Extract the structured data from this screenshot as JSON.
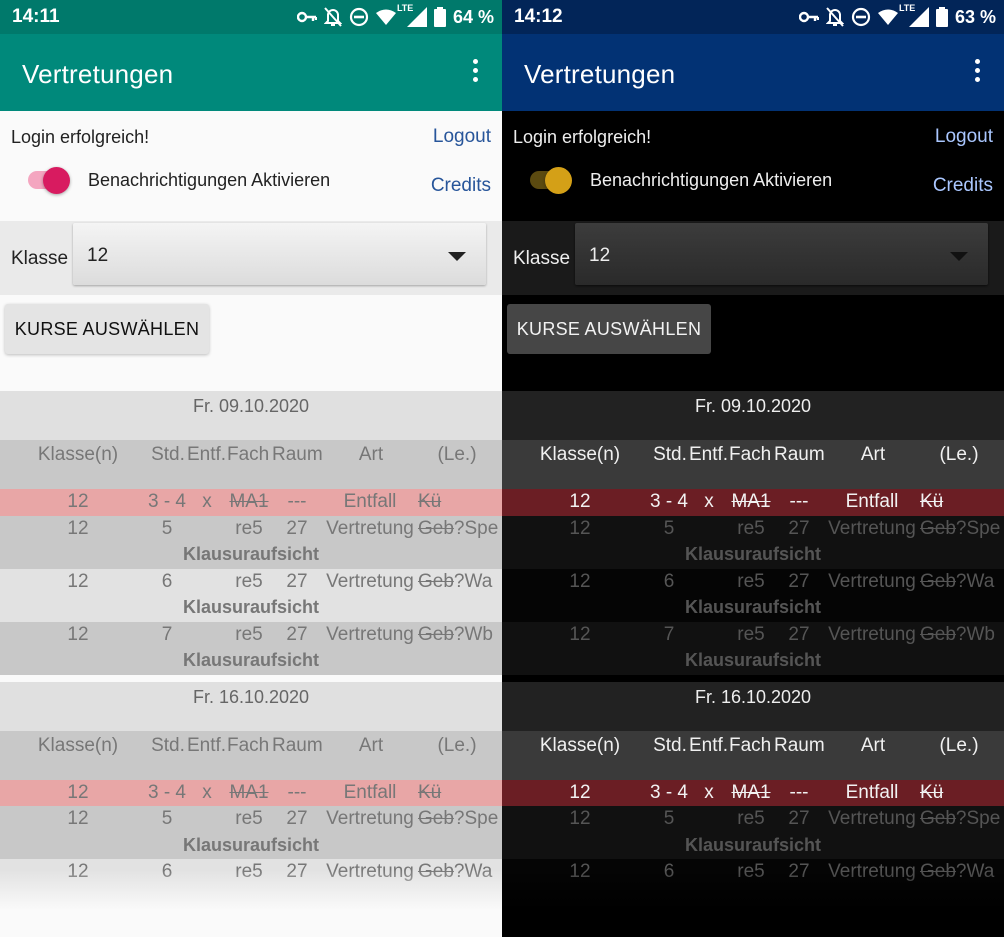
{
  "screens": [
    {
      "theme": "light",
      "status": {
        "time": "14:11",
        "battery": "64 %",
        "network": "LTE"
      },
      "appbar": {
        "title": "Vertretungen"
      },
      "login_text": "Login erfolgreich!",
      "logout_label": "Logout",
      "credits_label": "Credits",
      "notifications_label": "Benachrichtigungen Aktivieren",
      "notifications_enabled": true,
      "klasse_label": "Klasse",
      "klasse_value": "12",
      "kurse_button": "KURSE AUSWÄHLEN",
      "colors": {
        "appbar": "#00897b",
        "statusbar": "#00796b",
        "accent": "#d81b60",
        "entfall_row": "#e8a6a6"
      }
    },
    {
      "theme": "dark",
      "status": {
        "time": "14:12",
        "battery": "63 %",
        "network": "LTE"
      },
      "appbar": {
        "title": "Vertretungen"
      },
      "login_text": "Login erfolgreich!",
      "logout_label": "Logout",
      "credits_label": "Credits",
      "notifications_label": "Benachrichtigungen Aktivieren",
      "notifications_enabled": true,
      "klasse_label": "Klasse",
      "klasse_value": "12",
      "kurse_button": "KURSE AUSWÄHLEN",
      "colors": {
        "appbar": "#023274",
        "statusbar": "#022558",
        "accent": "#d4a017",
        "entfall_row": "#6b1e24"
      }
    }
  ],
  "table_headers": {
    "klasse": "Klasse(n)",
    "std": "Std.",
    "entf": "Entf.",
    "fach": "Fach",
    "raum": "Raum",
    "art": "Art",
    "le": "(Le.)"
  },
  "days": [
    {
      "date": "Fr. 09.10.2020",
      "entries": [
        {
          "klasse": "12",
          "std": "3 - 4",
          "entf": "x",
          "fach": "MA1",
          "raum": "---",
          "art": "Entfall",
          "le_struck": "Kü",
          "le_new": "",
          "note": "",
          "type": "entfall"
        },
        {
          "klasse": "12",
          "std": "5",
          "entf": "",
          "fach": "re5",
          "raum": "27",
          "art": "Vertretung",
          "le_struck": "Geb",
          "le_new": "?Spe",
          "note": "Klausuraufsicht",
          "type": "alt-a"
        },
        {
          "klasse": "12",
          "std": "6",
          "entf": "",
          "fach": "re5",
          "raum": "27",
          "art": "Vertretung",
          "le_struck": "Geb",
          "le_new": "?Wa",
          "note": "Klausuraufsicht",
          "type": "alt-b"
        },
        {
          "klasse": "12",
          "std": "7",
          "entf": "",
          "fach": "re5",
          "raum": "27",
          "art": "Vertretung",
          "le_struck": "Geb",
          "le_new": "?Wb",
          "note": "Klausuraufsicht",
          "type": "alt-a"
        }
      ]
    },
    {
      "date": "Fr. 16.10.2020",
      "entries": [
        {
          "klasse": "12",
          "std": "3 - 4",
          "entf": "x",
          "fach": "MA1",
          "raum": "---",
          "art": "Entfall",
          "le_struck": "Kü",
          "le_new": "",
          "note": "",
          "type": "entfall"
        },
        {
          "klasse": "12",
          "std": "5",
          "entf": "",
          "fach": "re5",
          "raum": "27",
          "art": "Vertretung",
          "le_struck": "Geb",
          "le_new": "?Spe",
          "note": "Klausuraufsicht",
          "type": "alt-a"
        },
        {
          "klasse": "12",
          "std": "6",
          "entf": "",
          "fach": "re5",
          "raum": "27",
          "art": "Vertretung",
          "le_struck": "Geb",
          "le_new": "?Wa",
          "note": "",
          "type": "alt-b"
        }
      ]
    }
  ]
}
